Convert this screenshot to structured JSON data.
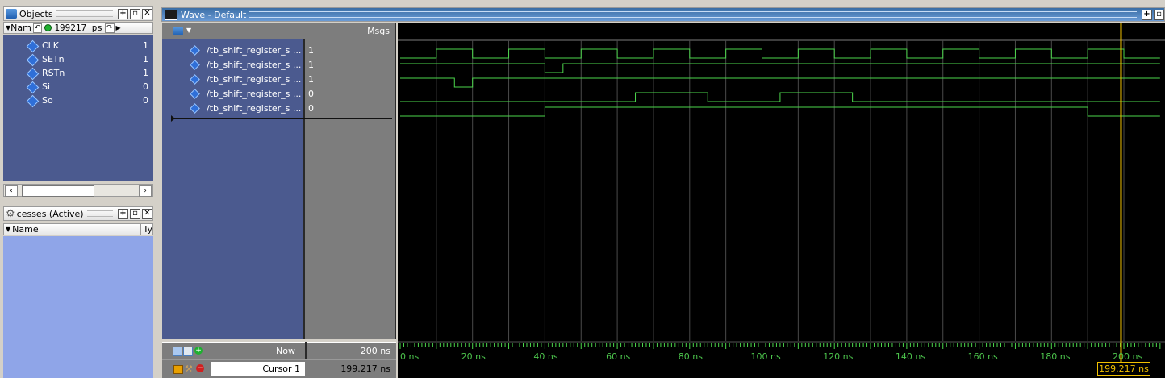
{
  "objects_panel": {
    "title": "Objects",
    "name_col": "Nam",
    "time": "199217 ps",
    "items": [
      {
        "name": "CLK",
        "value": "1"
      },
      {
        "name": "SETn",
        "value": "1"
      },
      {
        "name": "RSTn",
        "value": "1"
      },
      {
        "name": "Si",
        "value": "0"
      },
      {
        "name": "So",
        "value": "0"
      }
    ]
  },
  "processes_panel": {
    "title": "cesses (Active)",
    "col_name": "Name",
    "col_type": "Ty"
  },
  "wave_window": {
    "title": "Wave - Default",
    "msgs_header": "Msgs",
    "signals": [
      {
        "name": "/tb_shift_register_s ...",
        "value": "1"
      },
      {
        "name": "/tb_shift_register_s ...",
        "value": "1"
      },
      {
        "name": "/tb_shift_register_s ...",
        "value": "1"
      },
      {
        "name": "/tb_shift_register_s ...",
        "value": "0"
      },
      {
        "name": "/tb_shift_register_s ...",
        "value": "0"
      }
    ],
    "now_label": "Now",
    "now_value": "200 ns",
    "cursor_label": "Cursor 1",
    "cursor_value": "199.217 ns",
    "cursor_tag": "199.217 ns"
  },
  "timeline": {
    "tick_labels": [
      "0 ns",
      "20 ns",
      "40 ns",
      "60 ns",
      "80 ns",
      "100 ns",
      "120 ns",
      "140 ns",
      "160 ns",
      "180 ns",
      "200 ns"
    ],
    "cursor_ns": 199.217
  },
  "waveforms": {
    "time_max_ns": 210,
    "clk_edges_ns": [
      10,
      20,
      30,
      40,
      50,
      60,
      70,
      80,
      90,
      100,
      110,
      120,
      130,
      140,
      150,
      160,
      170,
      180,
      190,
      200
    ],
    "traces": [
      {
        "initial": 0,
        "transitions": [
          10,
          20,
          30,
          40,
          50,
          60,
          70,
          80,
          90,
          100,
          110,
          120,
          130,
          140,
          150,
          160,
          170,
          180,
          190,
          200
        ]
      },
      {
        "initial": 1,
        "transitions": [
          40,
          45
        ]
      },
      {
        "initial": 1,
        "transitions": [
          15,
          20
        ]
      },
      {
        "initial": 0,
        "transitions": [
          65,
          85,
          105,
          125
        ]
      },
      {
        "initial": 0,
        "transitions": [
          40,
          190
        ]
      }
    ]
  },
  "colors": {
    "wave": "#4cd64c",
    "cursor": "#f0c000",
    "grid": "#4a4a4a",
    "panel_blue": "#4b5a8f",
    "processes_blue": "#8fa5e8"
  }
}
